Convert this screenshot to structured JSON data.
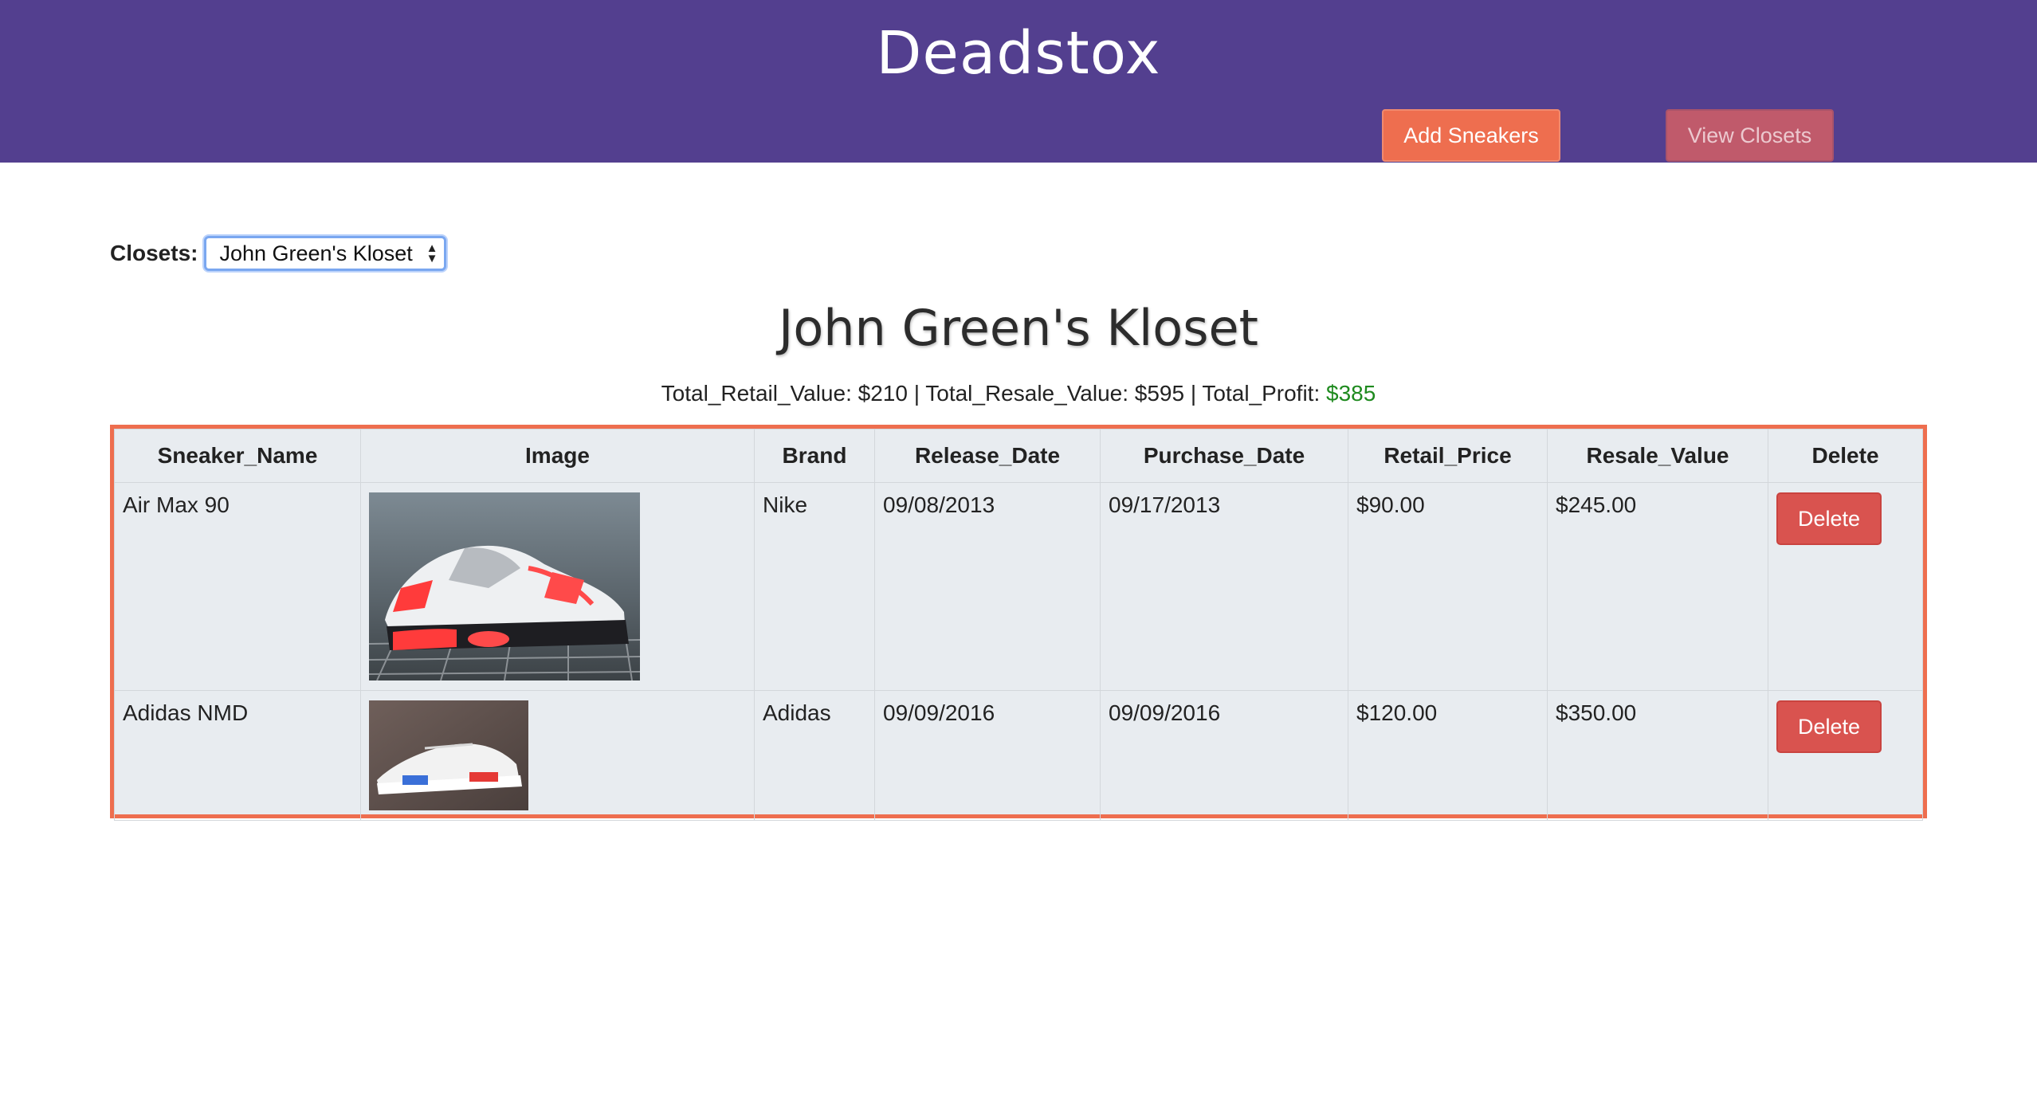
{
  "header": {
    "app_title": "Deadstox",
    "add_sneakers_label": "Add Sneakers",
    "view_closets_label": "View Closets"
  },
  "closet_selector": {
    "label": "Closets:",
    "selected": "John Green's Kloset"
  },
  "closet": {
    "title": "John Green's Kloset",
    "totals_prefix": "Total_Retail_Value: $210 | Total_Resale_Value: $595 | Total_Profit: ",
    "profit": "$385"
  },
  "table": {
    "headers": [
      "Sneaker_Name",
      "Image",
      "Brand",
      "Release_Date",
      "Purchase_Date",
      "Retail_Price",
      "Resale_Value",
      "Delete"
    ],
    "rows": [
      {
        "name": "Air Max 90",
        "brand": "Nike",
        "release_date": "09/08/2013",
        "purchase_date": "09/17/2013",
        "retail_price": "$90.00",
        "resale_value": "$245.00",
        "delete_label": "Delete"
      },
      {
        "name": "Adidas NMD",
        "brand": "Adidas",
        "release_date": "09/09/2016",
        "purchase_date": "09/09/2016",
        "retail_price": "$120.00",
        "resale_value": "$350.00",
        "delete_label": "Delete"
      }
    ]
  },
  "colors": {
    "header_bg": "#533f8f",
    "accent": "#ee6e4f",
    "delete": "#d9534f",
    "profit": "#1e8a1e"
  }
}
